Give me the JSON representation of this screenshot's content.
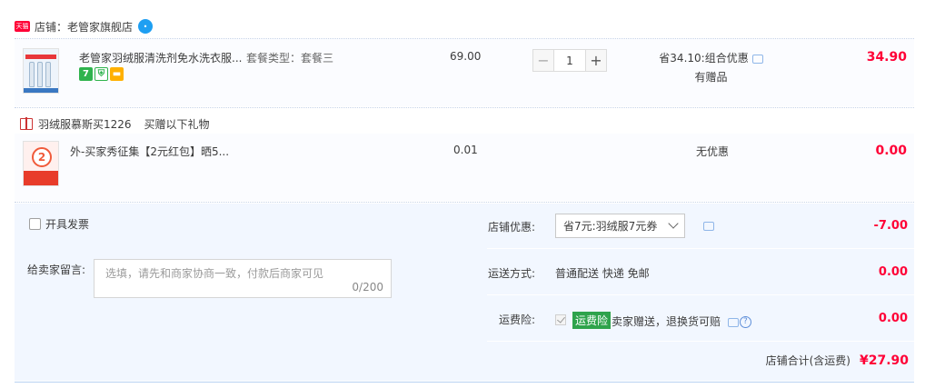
{
  "shop": {
    "badge": "天猫",
    "name": "店铺：老管家旗舰店"
  },
  "items": [
    {
      "title": "老管家羽绒服清洗剂免水洗衣服...",
      "sku": "套餐类型：套餐三",
      "price": "69.00",
      "quantity": "1",
      "discount_line1": "省34.10:组合优惠",
      "discount_line2": "有赠品",
      "total": "34.90",
      "badges": [
        "7",
        "shield-icon",
        "card-icon"
      ]
    }
  ],
  "gift": {
    "label": "羽绒服慕斯买1226",
    "note": "买赠以下礼物",
    "item": {
      "title": "外-买家秀征集【2元红包】晒5...",
      "thumb_text": "2",
      "price": "0.01",
      "discount": "无优惠",
      "total": "0.00"
    }
  },
  "order": {
    "invoice_label": "开具发票",
    "remark_label": "给卖家留言:",
    "remark_placeholder": "选填，请先和商家协商一致，付款后商家可见",
    "remark_count": "0/200",
    "shop_discount_label": "店铺优惠:",
    "shop_discount_value": "省7元:羽绒服7元券",
    "shop_discount_amount": "-7.00",
    "shipping_label": "运送方式:",
    "shipping_value": "普通配送 快递 免邮",
    "shipping_amount": "0.00",
    "insurance_label": "运费险:",
    "insurance_badge": "运费险",
    "insurance_text": "卖家赠送，退换货可赔",
    "insurance_amount": "0.00",
    "total_label": "店铺合计(含运费)",
    "total_amount": "¥27.90"
  }
}
